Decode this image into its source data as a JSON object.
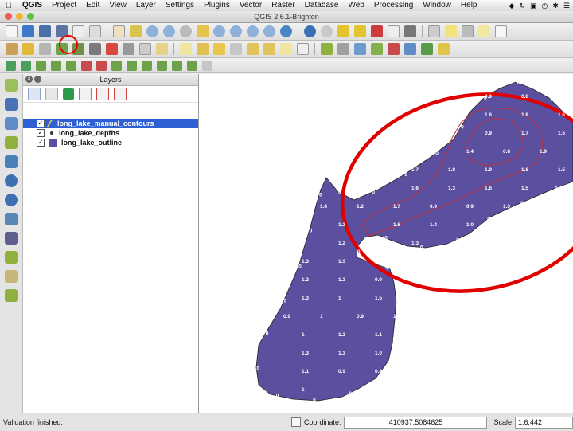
{
  "menubar": {
    "app": "QGIS",
    "items": [
      "Project",
      "Edit",
      "View",
      "Layer",
      "Settings",
      "Plugins",
      "Vector",
      "Raster",
      "Database",
      "Web",
      "Processing",
      "Window",
      "Help"
    ]
  },
  "window": {
    "title": "QGIS 2.6.1-Brighton"
  },
  "layers_panel": {
    "title": "Layers",
    "layers": [
      {
        "name": "long_lake_manual_contours",
        "checked": true,
        "selected": true,
        "symbol": "pencil-icon"
      },
      {
        "name": "long_lake_depths",
        "checked": true,
        "selected": false,
        "symbol": "point-icon"
      },
      {
        "name": "long_lake_outline",
        "checked": true,
        "selected": false,
        "symbol": "polygon-swatch"
      }
    ]
  },
  "map": {
    "lake_fill": "#5b4fa0",
    "contour_color": "#c0303b",
    "annotation_circle_color": "#e00000",
    "depth_labels": [
      "0",
      "0",
      "0",
      "0",
      "0",
      "0",
      "0",
      "0",
      "0",
      "0",
      "0",
      "0",
      "0",
      "0",
      "0",
      "0",
      "0",
      "0",
      "0",
      "0",
      "0",
      "0",
      "0",
      "0",
      "0",
      "0",
      "0",
      "0",
      "0",
      "0",
      "0.9",
      "0.8",
      "1.6",
      "1.8",
      "1.6",
      "0.9",
      "1.7",
      "1.5",
      "1.4",
      "0.8",
      "1.9",
      "1.7",
      "1.8",
      "1.9",
      "1.8",
      "1.5",
      "1.6",
      "1.3",
      "1.6",
      "1.5",
      "1.4",
      "1.2",
      "1.7",
      "0.9",
      "0.9",
      "1.3",
      "1.2",
      "1.6",
      "1.4",
      "1.0",
      "1.2",
      "1.3",
      "1.3",
      "1.3",
      "1.2",
      "1.2",
      "0.9",
      "1.3",
      "1",
      "1.5",
      "0.9",
      "1",
      "0.9",
      "1.2",
      "1",
      "1.2",
      "1.1",
      "1.3",
      "1.3",
      "1.0",
      "1.1",
      "0.9",
      "0.8",
      "1"
    ]
  },
  "status": {
    "message": "Validation finished.",
    "coordinate_label": "Coordinate:",
    "coordinate_value": "410937,5084625",
    "scale_label": "Scale",
    "scale_value": "1:6,442"
  }
}
